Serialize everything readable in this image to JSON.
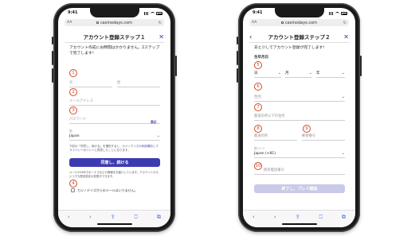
{
  "status_time": "9:41",
  "url": "casinodays.com",
  "aa": "AA",
  "step1": {
    "title": "アカウント登録ステップ１",
    "intro": "アカウント作成にお時間はかかりません。2ステップで完了します！",
    "first_name": "名",
    "last_name": "姓",
    "email": "メールアドレス",
    "password": "パスワード",
    "show_password": "表示",
    "country_label": "国",
    "country_value": "Japan",
    "terms_prefix": "下記の「同意し、続ける」を選択すると、カジノデイズの",
    "terms_link1": "利用規約",
    "terms_middle": "と",
    "terms_link2": "プライバシーポリシー",
    "terms_suffix": "に同意したことになります。",
    "submit": "同意し、続ける",
    "note": "メールやSMSでボーナスなどの情報をお届けしています。アカウントからいつでも配信設定の変更ができます。",
    "optout": "カジノデイズからのメールはいりません。",
    "markers": [
      "1",
      "2",
      "3",
      "4"
    ]
  },
  "step2": {
    "title": "アカウント登録ステップ２",
    "intro": "あと少しでアカウント登録が完了します！",
    "dob_label": "生年月日",
    "day": "日",
    "month": "月",
    "year": "年",
    "gender": "性別",
    "address": "都道府県以下の住所",
    "prefecture": "都道府県",
    "postal": "郵便番号",
    "country_code_label": "国コード",
    "country_code_value": "Japan (+81)",
    "phone": "携帯電話番号",
    "submit": "終了し、プレイ開始",
    "markers": [
      "5",
      "6",
      "7",
      "8",
      "9",
      "10"
    ]
  },
  "toolbar": {
    "back": "‹",
    "forward": "›",
    "share": "⇪",
    "bookmarks": "⎕",
    "tabs": "⧉"
  }
}
